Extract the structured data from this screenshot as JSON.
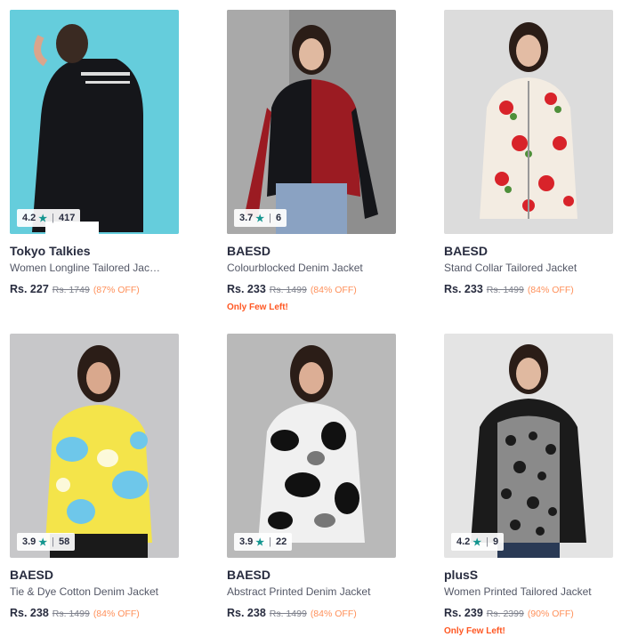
{
  "colors": {
    "star_green": "#14958f",
    "off_orange": "#ff905a",
    "few_left_red": "#ff5722"
  },
  "products": [
    {
      "brand": "Tokyo Talkies",
      "title": "Women Longline Tailored Jacket",
      "price": "Rs. 227",
      "mrp": "Rs. 1749",
      "discount": "(87% OFF)",
      "rating": "4.2",
      "rating_count": "417",
      "few_left": "",
      "image": "model-black-longline-jacket"
    },
    {
      "brand": "BAESD",
      "title": "Colourblocked Denim Jacket",
      "price": "Rs. 233",
      "mrp": "Rs. 1499",
      "discount": "(84% OFF)",
      "rating": "3.7",
      "rating_count": "6",
      "few_left": "Only Few Left!",
      "image": "model-red-black-denim-jacket"
    },
    {
      "brand": "BAESD",
      "title": "Stand Collar Tailored Jacket",
      "price": "Rs. 233",
      "mrp": "Rs. 1499",
      "discount": "(84% OFF)",
      "rating": "",
      "rating_count": "",
      "few_left": "",
      "image": "model-floral-white-jacket"
    },
    {
      "brand": "BAESD",
      "title": "Tie & Dye Cotton Denim Jacket",
      "price": "Rs. 238",
      "mrp": "Rs. 1499",
      "discount": "(84% OFF)",
      "rating": "3.9",
      "rating_count": "58",
      "few_left": "",
      "image": "model-yellow-blue-tie-dye-jacket"
    },
    {
      "brand": "BAESD",
      "title": "Abstract Printed Denim Jacket",
      "price": "Rs. 238",
      "mrp": "Rs. 1499",
      "discount": "(84% OFF)",
      "rating": "3.9",
      "rating_count": "22",
      "few_left": "",
      "image": "model-black-white-abstract-jacket"
    },
    {
      "brand": "plusS",
      "title": "Women Printed Tailored Jacket",
      "price": "Rs. 239",
      "mrp": "Rs. 2399",
      "discount": "(90% OFF)",
      "rating": "4.2",
      "rating_count": "9",
      "few_left": "Only Few Left!",
      "image": "model-leopard-print-jacket"
    }
  ]
}
